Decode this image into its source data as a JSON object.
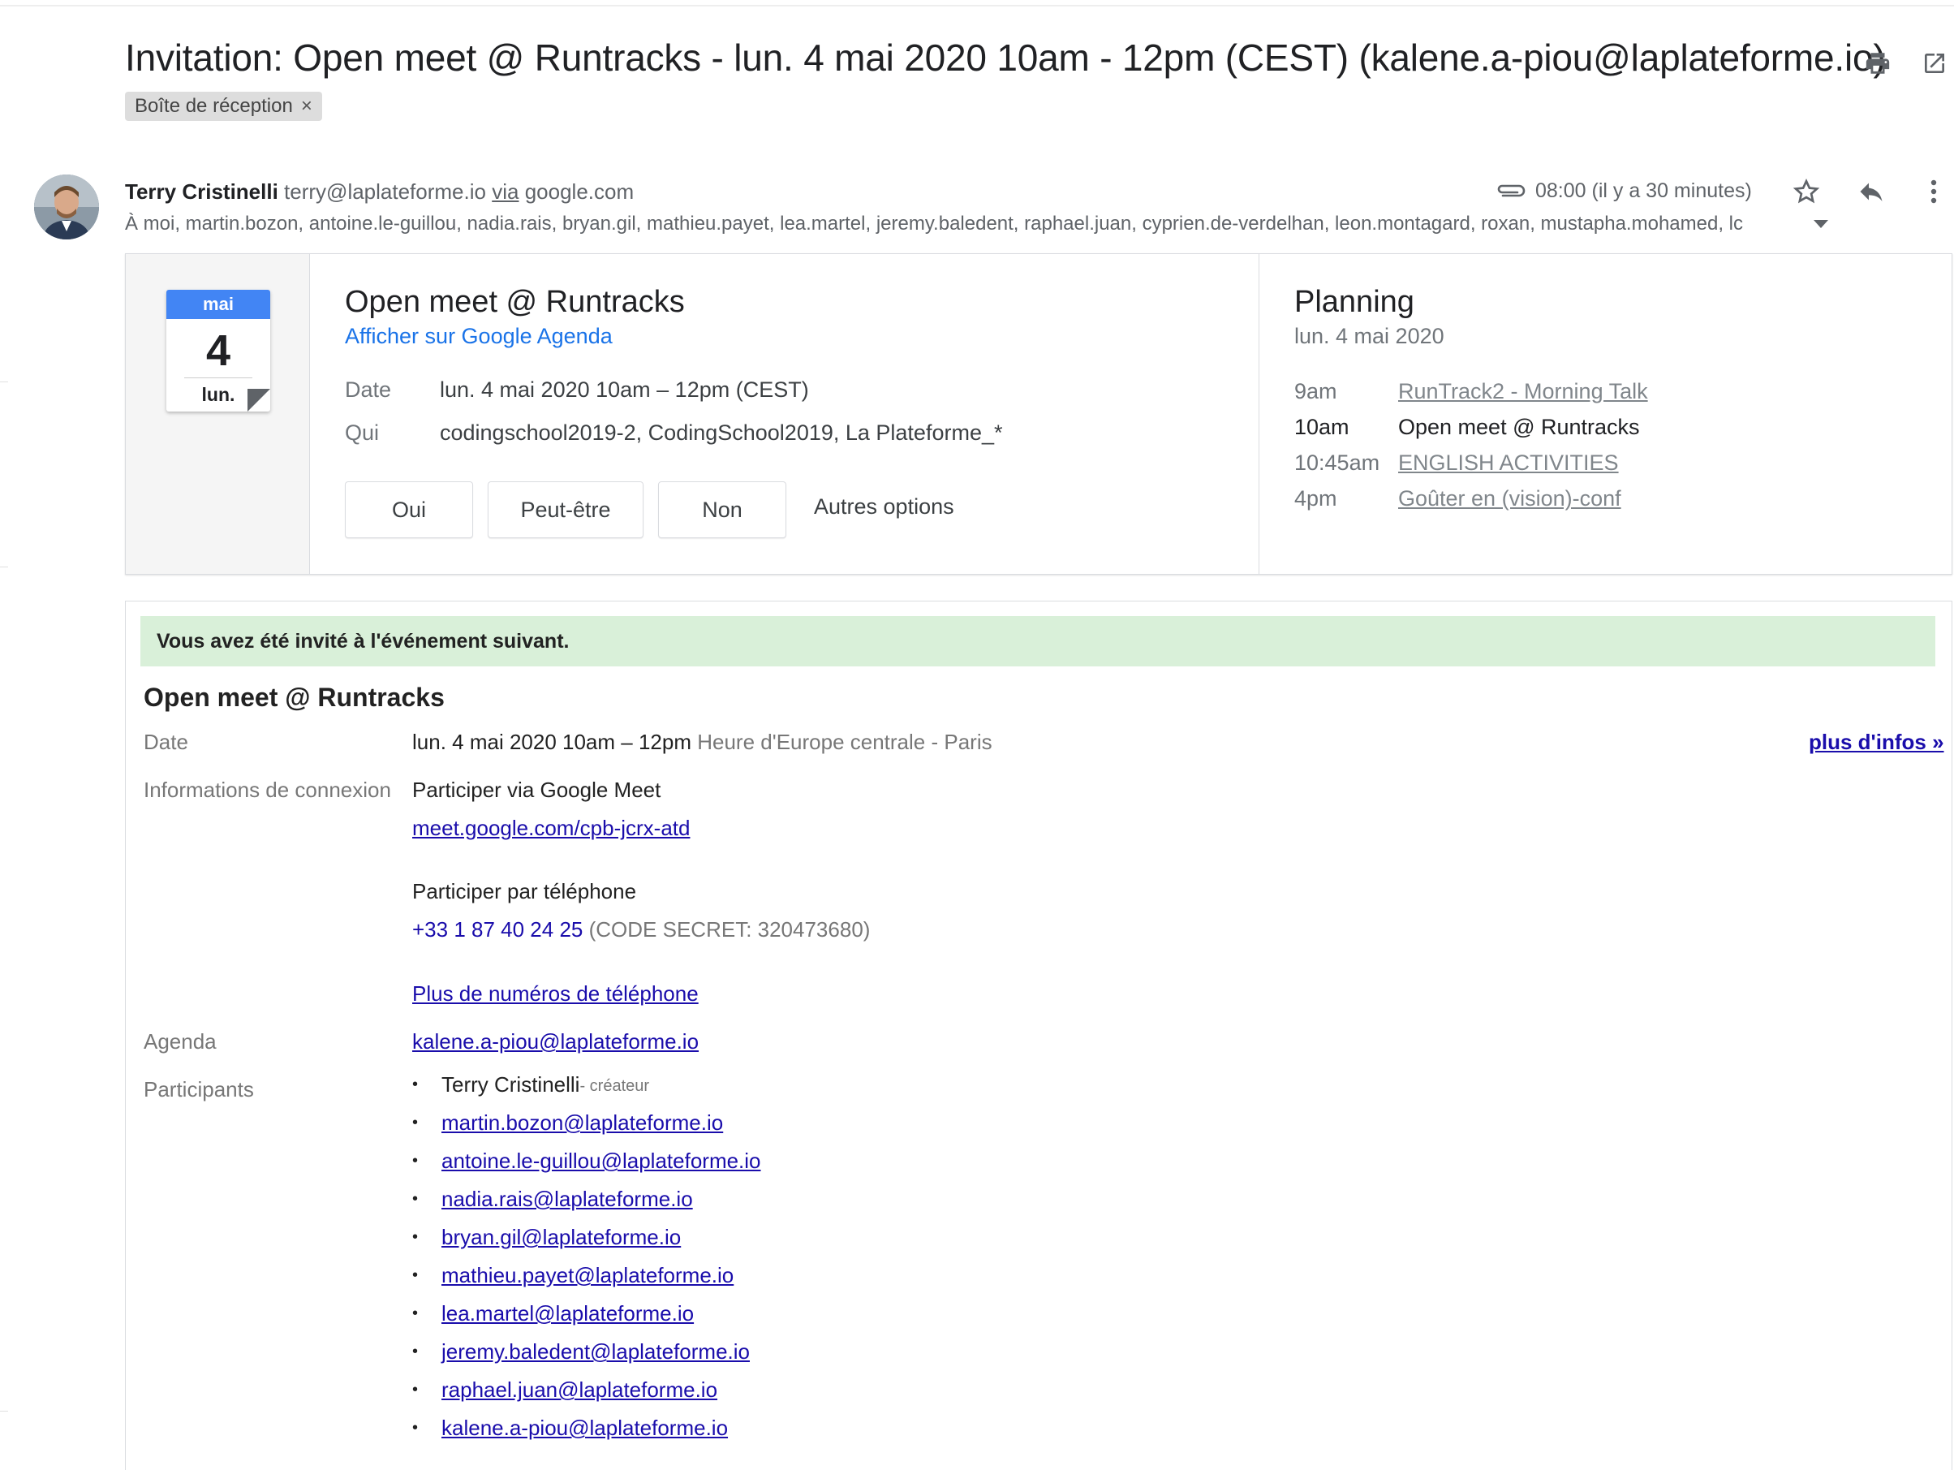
{
  "email": {
    "subject": "Invitation: Open meet @ Runtracks - lun. 4 mai 2020 10am - 12pm (CEST) (kalene.a-piou@laplateforme.io)",
    "label_chip": "Boîte de réception",
    "label_remove": "×",
    "sender_name": "Terry Cristinelli",
    "sender_email": "terry@laplateforme.io",
    "sender_via": "via",
    "sender_domain": "google.com",
    "recipients": "À moi, martin.bozon, antoine.le-guillou, nadia.rais, bryan.gil, mathieu.payet, lea.martel, jeremy.baledent, raphael.juan, cyprien.de-verdelhan, leon.montagard, roxan, mustapha.mohamed, lc",
    "time": "08:00 (il y a 30 minutes)"
  },
  "card": {
    "cal_month": "mai",
    "cal_day": "4",
    "cal_dow": "lun.",
    "event_title": "Open meet @ Runtracks",
    "view_link": "Afficher sur Google Agenda",
    "date_label": "Date",
    "date_value": "lun. 4 mai 2020 10am – 12pm (CEST)",
    "who_label": "Qui",
    "who_value": "codingschool2019-2, CodingSchool2019, La Plateforme_*",
    "rsvp_yes": "Oui",
    "rsvp_maybe": "Peut-être",
    "rsvp_no": "Non",
    "more_options": "Autres options",
    "planning_title": "Planning",
    "planning_date": "lun. 4 mai 2020",
    "planning": [
      {
        "time": "9am",
        "title": "RunTrack2 - Morning Talk"
      },
      {
        "time": "10am",
        "title": "Open meet @ Runtracks"
      },
      {
        "time": "10:45am",
        "title": "ENGLISH ACTIVITIES"
      },
      {
        "time": "4pm",
        "title": "Goûter en (vision)-conf"
      }
    ]
  },
  "body": {
    "banner": "Vous avez été invité à l'événement suivant.",
    "title": "Open meet @ Runtracks",
    "more_info": "plus d'infos »",
    "date_label": "Date",
    "date_value": "lun. 4 mai 2020 10am – 12pm",
    "date_tz": "Heure d'Europe centrale - Paris",
    "conn_label": "Informations de connexion",
    "meet_heading": "Participer via Google Meet",
    "meet_link": "meet.google.com/cpb-jcrx-atd",
    "phone_heading": "Participer par téléphone",
    "phone_number": "+33 1 87 40 24 25",
    "phone_code": "(CODE SECRET: 320473680)",
    "more_phones": "Plus de numéros de téléphone",
    "agenda_label": "Agenda",
    "agenda_value": "kalene.a-piou@laplateforme.io",
    "participants_label": "Participants",
    "organizer": "Terry Cristinelli",
    "organizer_role": "- créateur",
    "participants": [
      "martin.bozon@laplateforme.io",
      "antoine.le-guillou@laplateforme.io",
      "nadia.rais@laplateforme.io",
      "bryan.gil@laplateforme.io",
      "mathieu.payet@laplateforme.io",
      "lea.martel@laplateforme.io",
      "jeremy.baledent@laplateforme.io",
      "raphael.juan@laplateforme.io",
      "kalene.a-piou@laplateforme.io"
    ]
  }
}
